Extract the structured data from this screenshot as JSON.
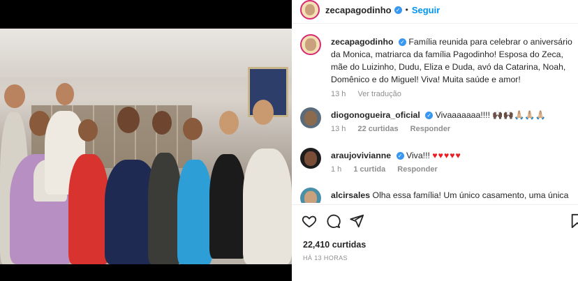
{
  "post": {
    "author": "zecapagodinho",
    "follow_label": "Seguir",
    "separator": "•",
    "caption": "Família reunida para celebrar o aniversário da Monica, matriarca da família Pagodinho! Esposa do Zeca, mãe do Luizinho, Dudu, Eliza e Duda, avó da Catarina, Noah, Domênico e do Miguel! Viva! Muita saúde e amor!",
    "caption_time": "13 h",
    "translate_label": "Ver tradução",
    "likes": "22,410 curtidas",
    "posted_ago": "HÁ 13 HORAS"
  },
  "comments": [
    {
      "user": "diogonogueira_oficial",
      "verified": true,
      "text": "Vivaaaaaaa!!!! 🙌🏿🙌🏿🙏🏼🙏🏼🙏🏼",
      "time": "13 h",
      "likes": "22 curtidas",
      "reply": "Responder"
    },
    {
      "user": "araujovivianne",
      "verified": true,
      "text": "Viva!!!",
      "hearts": "♥♥♥♥♥",
      "time": "1 h",
      "likes": "1 curtida",
      "reply": "Responder"
    },
    {
      "user": "alcirsales",
      "verified": false,
      "text": "Olha essa família! Um único casamento, uma única"
    }
  ],
  "icons": [
    "heart-icon",
    "comment-icon",
    "share-icon",
    "bookmark-icon"
  ],
  "colors": {
    "accent": "#0095f6",
    "verified": "#3897f0",
    "heart": "#ed1c24",
    "muted": "#8e8e8e"
  }
}
